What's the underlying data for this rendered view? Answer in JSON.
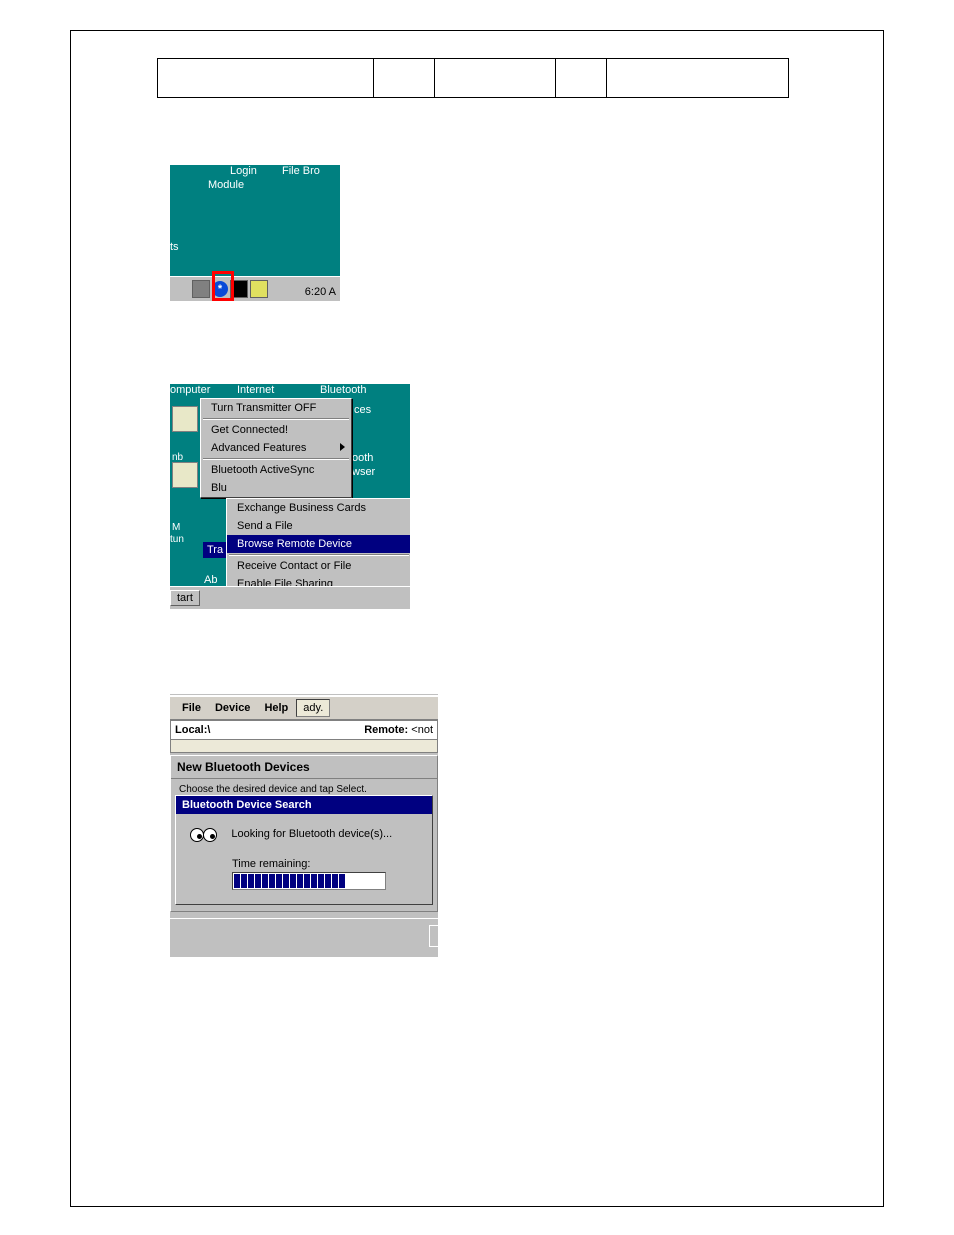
{
  "shot1": {
    "label_login": "Login",
    "label_module": "Module",
    "label_file": "File Bro",
    "label_ts": "ts",
    "bt_glyph": "*",
    "clock": "6:20 A"
  },
  "shot2": {
    "desktop": {
      "computer": "omputer",
      "internet": "Internet",
      "bluetooth": "Bluetooth",
      "ces": "ces",
      "oth": "ooth",
      "wser": "wser",
      "nb": "nb",
      "my": "M",
      "tun": "tun",
      "tra": "Tra",
      "ab": "Ab",
      "start": "tart",
      "blu": "Blu"
    },
    "menu1": {
      "turn_off": "Turn Transmitter OFF",
      "get_connected": "Get Connected!",
      "advanced": "Advanced Features",
      "activesync": "Bluetooth ActiveSync"
    },
    "menu2": {
      "exchange": "Exchange Business Cards",
      "send": "Send a File",
      "browse": "Browse Remote Device",
      "receive": "Receive Contact or File",
      "enable": "Enable File Sharing"
    }
  },
  "shot3": {
    "menu_file": "File",
    "menu_device": "Device",
    "menu_help": "Help",
    "field_ready": "ady.",
    "local": "Local:\\",
    "remote_label": "Remote:",
    "remote_value": "<not",
    "panel_title": "New Bluetooth Devices",
    "panel_sub": "Choose the desired device and tap Select.",
    "dlg_title": "Bluetooth Device Search",
    "looking": "Looking for Bluetooth device(s)...",
    "time_remaining": "Time remaining:"
  }
}
